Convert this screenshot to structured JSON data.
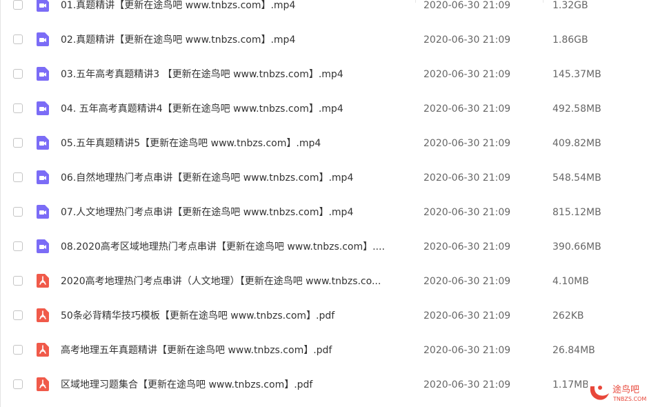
{
  "icons": {
    "video": {
      "name": "video-file-icon",
      "color": "#7b6cf6"
    },
    "pdf": {
      "name": "pdf-file-icon",
      "color": "#f05a4a"
    }
  },
  "files": [
    {
      "name": "01.真题精讲【更新在途鸟吧 www.tnbzs.com】.mp4",
      "date": "2020-06-30 21:09",
      "size": "1.32GB",
      "type": "video"
    },
    {
      "name": "02.真题精讲【更新在途鸟吧 www.tnbzs.com】.mp4",
      "date": "2020-06-30 21:09",
      "size": "1.86GB",
      "type": "video"
    },
    {
      "name": "03.五年高考真题精讲3 【更新在途鸟吧 www.tnbzs.com】.mp4",
      "date": "2020-06-30 21:09",
      "size": "145.37MB",
      "type": "video"
    },
    {
      "name": "04. 五年高考真题精讲4【更新在途鸟吧 www.tnbzs.com】.mp4",
      "date": "2020-06-30 21:09",
      "size": "492.58MB",
      "type": "video"
    },
    {
      "name": "05.五年真题精讲5【更新在途鸟吧 www.tnbzs.com】.mp4",
      "date": "2020-06-30 21:09",
      "size": "409.82MB",
      "type": "video"
    },
    {
      "name": "06.自然地理热门考点串讲【更新在途鸟吧 www.tnbzs.com】.mp4",
      "date": "2020-06-30 21:09",
      "size": "548.54MB",
      "type": "video"
    },
    {
      "name": "07.人文地理热门考点串讲【更新在途鸟吧 www.tnbzs.com】.mp4",
      "date": "2020-06-30 21:09",
      "size": "815.12MB",
      "type": "video"
    },
    {
      "name": "08.2020高考区域地理热门考点串讲【更新在途鸟吧 www.tnbzs.com】....",
      "date": "2020-06-30 21:09",
      "size": "390.66MB",
      "type": "video"
    },
    {
      "name": "2020高考地理热门考点串讲（人文地理）【更新在途鸟吧 www.tnbzs.co...",
      "date": "2020-06-30 21:09",
      "size": "4.10MB",
      "type": "pdf"
    },
    {
      "name": "50条必背精华技巧模板【更新在途鸟吧 www.tnbzs.com】.pdf",
      "date": "2020-06-30 21:09",
      "size": "262KB",
      "type": "pdf"
    },
    {
      "name": "高考地理五年真题精讲【更新在途鸟吧 www.tnbzs.com】.pdf",
      "date": "2020-06-30 21:09",
      "size": "26.84MB",
      "type": "pdf"
    },
    {
      "name": "区域地理习题集合【更新在途鸟吧 www.tnbzs.com】.pdf",
      "date": "2020-06-30 21:09",
      "size": "1.17MB",
      "type": "pdf"
    }
  ],
  "watermark": {
    "text": "途鸟吧",
    "url": "TNBZS.COM",
    "color": "#e8473a"
  }
}
